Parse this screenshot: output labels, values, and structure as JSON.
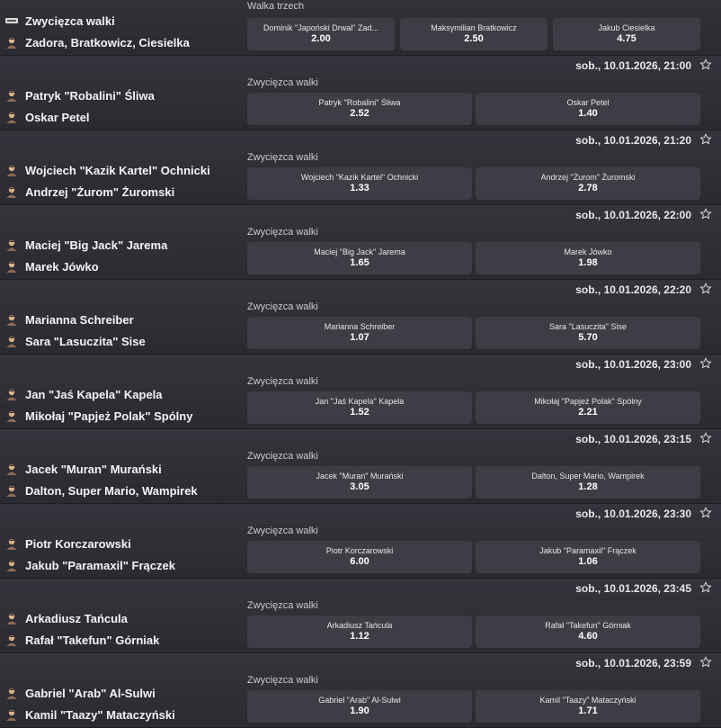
{
  "events": [
    {
      "datetime": "",
      "market": "Walka trzech",
      "participants": [
        "Zwycięzca walki",
        "Zadora, Bratkowicz, Ciesielka"
      ],
      "avatars": [
        "league-logo-icon",
        "fighter-avatar-icon"
      ],
      "odds": [
        {
          "name": "Dominik \"Japoński Drwal\" Zad...",
          "value": "2.00"
        },
        {
          "name": "Maksymilian Bratkowicz",
          "value": "2.50"
        },
        {
          "name": "Jakub Ciesielka",
          "value": "4.75"
        }
      ]
    },
    {
      "datetime": "sob., 10.01.2026, 21:00",
      "market": "Zwycięzca walki",
      "participants": [
        "Patryk \"Robalini\" Śliwa",
        "Oskar Petel"
      ],
      "avatars": [
        "fighter-avatar-icon",
        "fighter-avatar-icon"
      ],
      "odds": [
        {
          "name": "Patryk \"Robalini\" Śliwa",
          "value": "2.52"
        },
        {
          "name": "Oskar Petel",
          "value": "1.40"
        }
      ]
    },
    {
      "datetime": "sob., 10.01.2026, 21:20",
      "market": "Zwycięzca walki",
      "participants": [
        "Wojciech \"Kazik Kartel\" Ochnicki",
        "Andrzej \"Żurom\" Żuromski"
      ],
      "avatars": [
        "fighter-avatar-icon",
        "fighter-avatar-icon"
      ],
      "odds": [
        {
          "name": "Wojciech \"Kazik Kartel\" Ochnicki",
          "value": "1.33"
        },
        {
          "name": "Andrzej \"Żurom\" Żuromski",
          "value": "2.78"
        }
      ]
    },
    {
      "datetime": "sob., 10.01.2026, 22:00",
      "market": "Zwycięzca walki",
      "participants": [
        "Maciej \"Big Jack\" Jarema",
        "Marek Jówko"
      ],
      "avatars": [
        "fighter-avatar-icon",
        "fighter-avatar-icon"
      ],
      "odds": [
        {
          "name": "Maciej \"Big Jack\" Jarema",
          "value": "1.65"
        },
        {
          "name": "Marek Jówko",
          "value": "1.98"
        }
      ]
    },
    {
      "datetime": "sob., 10.01.2026, 22:20",
      "market": "Zwycięzca walki",
      "participants": [
        "Marianna Schreiber",
        "Sara \"Lasuczita\" Sise"
      ],
      "avatars": [
        "fighter-avatar-icon",
        "fighter-avatar-icon"
      ],
      "odds": [
        {
          "name": "Marianna Schreiber",
          "value": "1.07"
        },
        {
          "name": "Sara \"Lasuczita\" Sise",
          "value": "5.70"
        }
      ]
    },
    {
      "datetime": "sob., 10.01.2026, 23:00",
      "market": "Zwycięzca walki",
      "participants": [
        "Jan \"Jaś Kapela\" Kapela",
        "Mikołaj \"Papjeż Polak\" Spólny"
      ],
      "avatars": [
        "fighter-avatar-icon",
        "fighter-avatar-icon"
      ],
      "odds": [
        {
          "name": "Jan \"Jaś Kapela\" Kapela",
          "value": "1.52"
        },
        {
          "name": "Mikołaj \"Papjeż Polak\" Spólny",
          "value": "2.21"
        }
      ]
    },
    {
      "datetime": "sob., 10.01.2026, 23:15",
      "market": "Zwycięzca walki",
      "participants": [
        "Jacek \"Muran\" Murański",
        "Dalton, Super Mario, Wampirek"
      ],
      "avatars": [
        "fighter-avatar-icon",
        "fighter-avatar-icon"
      ],
      "odds": [
        {
          "name": "Jacek \"Muran\" Murański",
          "value": "3.05"
        },
        {
          "name": "Dalton, Super Mario, Wampirek",
          "value": "1.28"
        }
      ]
    },
    {
      "datetime": "sob., 10.01.2026, 23:30",
      "market": "Zwycięzca walki",
      "participants": [
        "Piotr Korczarowski",
        "Jakub \"Paramaxil\" Frączek"
      ],
      "avatars": [
        "fighter-avatar-icon",
        "fighter-avatar-icon"
      ],
      "odds": [
        {
          "name": "Piotr Korczarowski",
          "value": "6.00"
        },
        {
          "name": "Jakub \"Paramaxil\" Frączek",
          "value": "1.06"
        }
      ]
    },
    {
      "datetime": "sob., 10.01.2026, 23:45",
      "market": "Zwycięzca walki",
      "participants": [
        "Arkadiusz Tańcula",
        "Rafał \"Takefun\" Górniak"
      ],
      "avatars": [
        "fighter-avatar-icon",
        "fighter-avatar-icon"
      ],
      "odds": [
        {
          "name": "Arkadiusz Tańcula",
          "value": "1.12"
        },
        {
          "name": "Rafał \"Takefun\" Górniak",
          "value": "4.60"
        }
      ]
    },
    {
      "datetime": "sob., 10.01.2026, 23:59",
      "market": "Zwycięzca walki",
      "participants": [
        "Gabriel \"Arab\" Al-Sulwi",
        "Kamil \"Taazy\" Mataczyński"
      ],
      "avatars": [
        "fighter-avatar-icon",
        "fighter-avatar-icon"
      ],
      "odds": [
        {
          "name": "Gabriel \"Arab\" Al-Sulwi",
          "value": "1.90"
        },
        {
          "name": "Kamil \"Taazy\" Mataczyński",
          "value": "1.71"
        }
      ]
    }
  ],
  "icons": {
    "favorite": "star-outline-icon"
  },
  "colors": {
    "background": "#2b2b31",
    "odds_button": "#3d3d45",
    "text": "#ffffff"
  }
}
